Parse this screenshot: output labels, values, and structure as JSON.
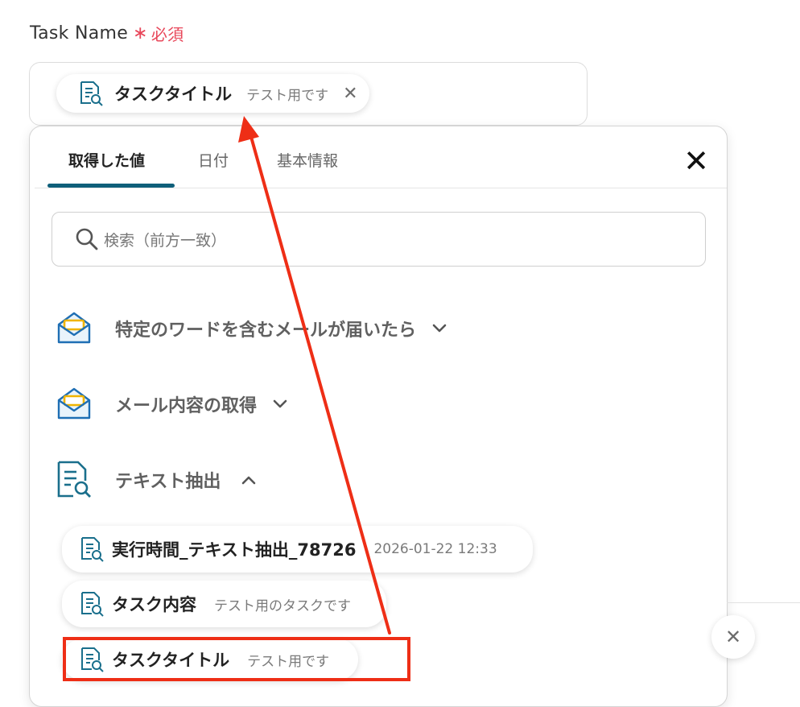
{
  "field": {
    "label": "Task Name",
    "required_star": "∗",
    "required_text": "必須",
    "selected_chip": {
      "name": "タスクタイトル",
      "value": "テスト用です",
      "close": "✕",
      "icon": "document-search-icon"
    }
  },
  "panel": {
    "tabs": [
      "取得した値",
      "日付",
      "基本情報"
    ],
    "active_tab": "取得した値",
    "close": "✕",
    "search_placeholder": "検索（前方一致）",
    "sections": [
      {
        "label": "特定のワードを含むメールが届いたら",
        "icon": "mail-icon",
        "expanded": false
      },
      {
        "label": "メール内容の取得",
        "icon": "mail-icon",
        "expanded": false
      },
      {
        "label": "テキスト抽出",
        "icon": "document-search-icon",
        "expanded": true
      }
    ],
    "items": [
      {
        "name": "実行時間_テキスト抽出_78726",
        "value": "2026-01-22 12:33"
      },
      {
        "name": "タスク内容",
        "value": "テスト用のタスクです"
      },
      {
        "name": "タスクタイトル",
        "value": "テスト用です"
      }
    ]
  },
  "side": {
    "close": "✕"
  },
  "colors": {
    "accent": "#0f5f7a",
    "required": "#e8475a",
    "annotation": "#ee2e16",
    "mail_yellow": "#f0b400",
    "mail_blue": "#1f6fb4"
  }
}
